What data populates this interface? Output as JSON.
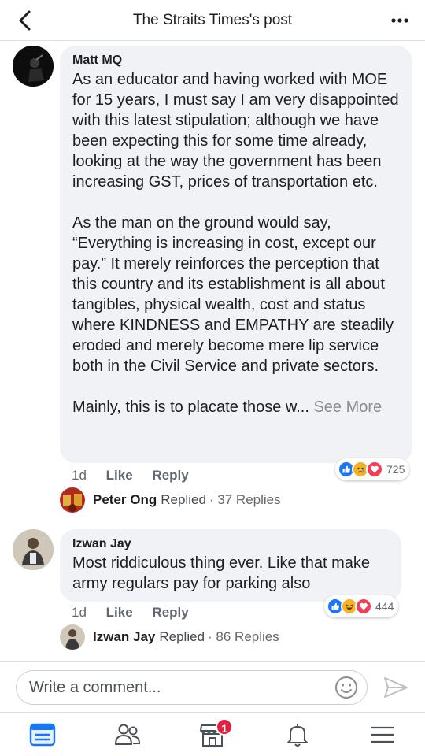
{
  "header": {
    "title": "The Straits Times's post"
  },
  "comments": [
    {
      "author": "Matt MQ",
      "text_p1": "As an educator and having worked with MOE for 15 years, I must say I am very disappointed with this latest stipulation; although we have been expecting this for some time already, looking at the way the government has been increasing GST, prices of transportation etc.",
      "text_p2": "As the man on the ground would say, “Everything is increasing in cost, except our pay.” It merely reinforces the perception that this country and its establishment is all about tangibles, physical wealth, cost and status where KINDNESS and EMPATHY are steadily eroded and merely become mere lip service both in the Civil Service and private sectors.",
      "text_p3": "Mainly, this is to placate those w...",
      "see_more": "See More",
      "time": "1d",
      "like_label": "Like",
      "reply_label": "Reply",
      "reaction_count": "725",
      "reactions": [
        "like-reaction-icon",
        "sad-reaction-icon",
        "love-reaction-icon"
      ],
      "replies": {
        "name": "Peter Ong",
        "replied": "Replied",
        "count": "· 37 Replies"
      }
    },
    {
      "author": "Izwan Jay",
      "text": "Most riddiculous thing ever. Like that make army regulars pay for parking also",
      "time": "1d",
      "like_label": "Like",
      "reply_label": "Reply",
      "reaction_count": "444",
      "reactions": [
        "like-reaction-icon",
        "haha-reaction-icon",
        "love-reaction-icon"
      ],
      "replies": {
        "name": "Izwan Jay",
        "replied": "Replied",
        "count": "· 86 Replies"
      }
    }
  ],
  "composer": {
    "placeholder": "Write a comment..."
  },
  "tabbar": {
    "items": [
      "news-feed-icon",
      "friends-icon",
      "marketplace-icon",
      "notifications-icon",
      "menu-icon"
    ],
    "badge": "1"
  },
  "colors": {
    "like_blue": "#1877f2",
    "love_red": "#f33e58",
    "sad_yellow": "#f7b125",
    "badge_red": "#e41e3f",
    "bubble_gray": "#f0f2f5"
  }
}
